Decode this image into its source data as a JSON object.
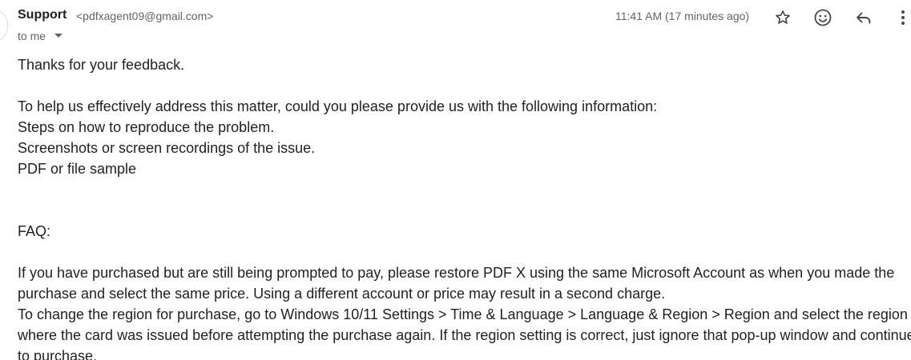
{
  "header": {
    "sender_name": "Support",
    "sender_email": "<pdfxagent09@gmail.com>",
    "recipient": "to me",
    "timestamp": "11:41 AM (17 minutes ago)",
    "icons": [
      "star-icon",
      "emoji-icon",
      "reply-icon",
      "more-vert-icon"
    ]
  },
  "body": {
    "greeting": "Thanks for your feedback.",
    "request_intro": "To help us effectively address this matter, could you please provide us with the following information:",
    "request_items": [
      "Steps on how to reproduce the problem.",
      "Screenshots or screen recordings of the issue.",
      "PDF or file sample"
    ],
    "faq_heading": "FAQ:",
    "faq_items": [
      "If you have purchased but are still being prompted to pay, please restore PDF X using the same Microsoft Account as when you made the purchase and select the same price. Using a different account or price may result in a second charge.",
      "To change the region for purchase, go to Windows 10/11 Settings > Time & Language > Language & Region > Region and select the region where the card was issued before attempting the purchase again. If the region setting is correct, just ignore that pop-up window and continue to purchase."
    ]
  },
  "colors": {
    "text": "#222222",
    "secondary_text": "#5f6368",
    "icon": "#444746"
  }
}
